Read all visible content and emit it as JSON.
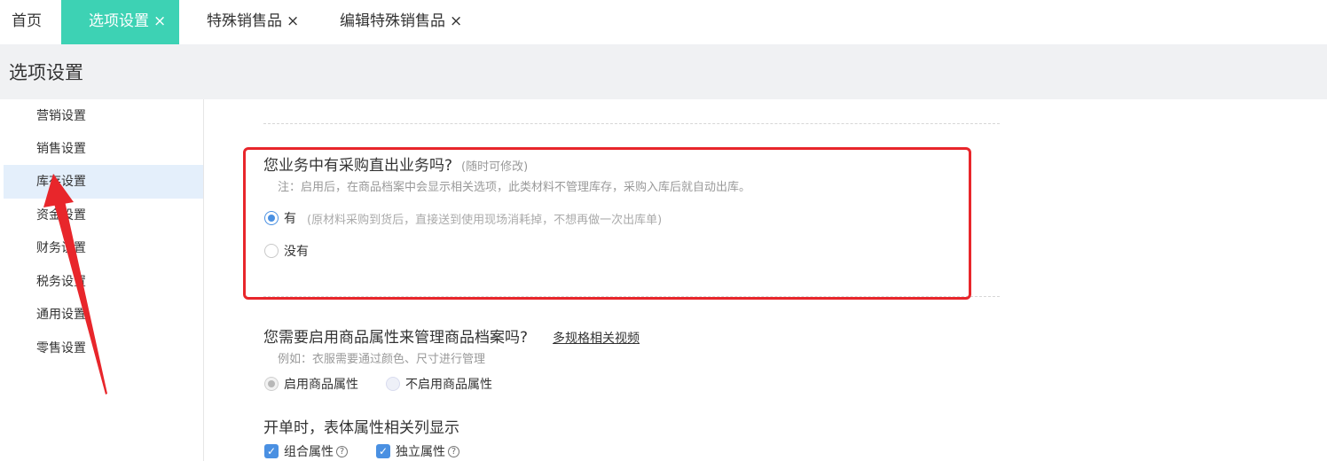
{
  "tabs": [
    {
      "label": "首页",
      "closable": false,
      "active": false
    },
    {
      "label": "选项设置",
      "closable": true,
      "active": true
    },
    {
      "label": "特殊销售品",
      "closable": true,
      "active": false
    },
    {
      "label": "编辑特殊销售品",
      "closable": true,
      "active": false
    }
  ],
  "close_glyph": "×",
  "page_title": "选项设置",
  "sidebar": {
    "items": [
      {
        "label": "营销设置"
      },
      {
        "label": "销售设置"
      },
      {
        "label": "库存设置",
        "active": true
      },
      {
        "label": "资金设置"
      },
      {
        "label": "财务设置"
      },
      {
        "label": "税务设置"
      },
      {
        "label": "通用设置"
      },
      {
        "label": "零售设置"
      }
    ]
  },
  "purchase_direct": {
    "question": "您业务中有采购直出业务吗?",
    "hint": "(随时可修改)",
    "note": "注：启用后，在商品档案中会显示相关选项，此类材料不管理库存，采购入库后就自动出库。",
    "options": [
      {
        "label": "有",
        "desc": "(原材料采购到货后，直接送到使用现场消耗掉，不想再做一次出库单)",
        "checked": true
      },
      {
        "label": "没有",
        "checked": false
      }
    ]
  },
  "attributes": {
    "question": "您需要启用商品属性来管理商品档案吗?",
    "video_link": "多规格相关视频",
    "example": "例如：衣服需要通过颜色、尺寸进行管理",
    "options": [
      {
        "label": "启用商品属性",
        "checked": true
      },
      {
        "label": "不启用商品属性",
        "checked": false
      }
    ]
  },
  "columns": {
    "title": "开单时，表体属性相关列显示",
    "checkboxes": [
      {
        "label": "组合属性",
        "checked": true
      },
      {
        "label": "独立属性",
        "checked": true
      }
    ],
    "help_glyph": "?"
  },
  "colors": {
    "accent_tab": "#3dd2b4",
    "primary": "#4a90e2",
    "highlight_red": "#e8262b",
    "sidebar_active": "#e4effb"
  }
}
